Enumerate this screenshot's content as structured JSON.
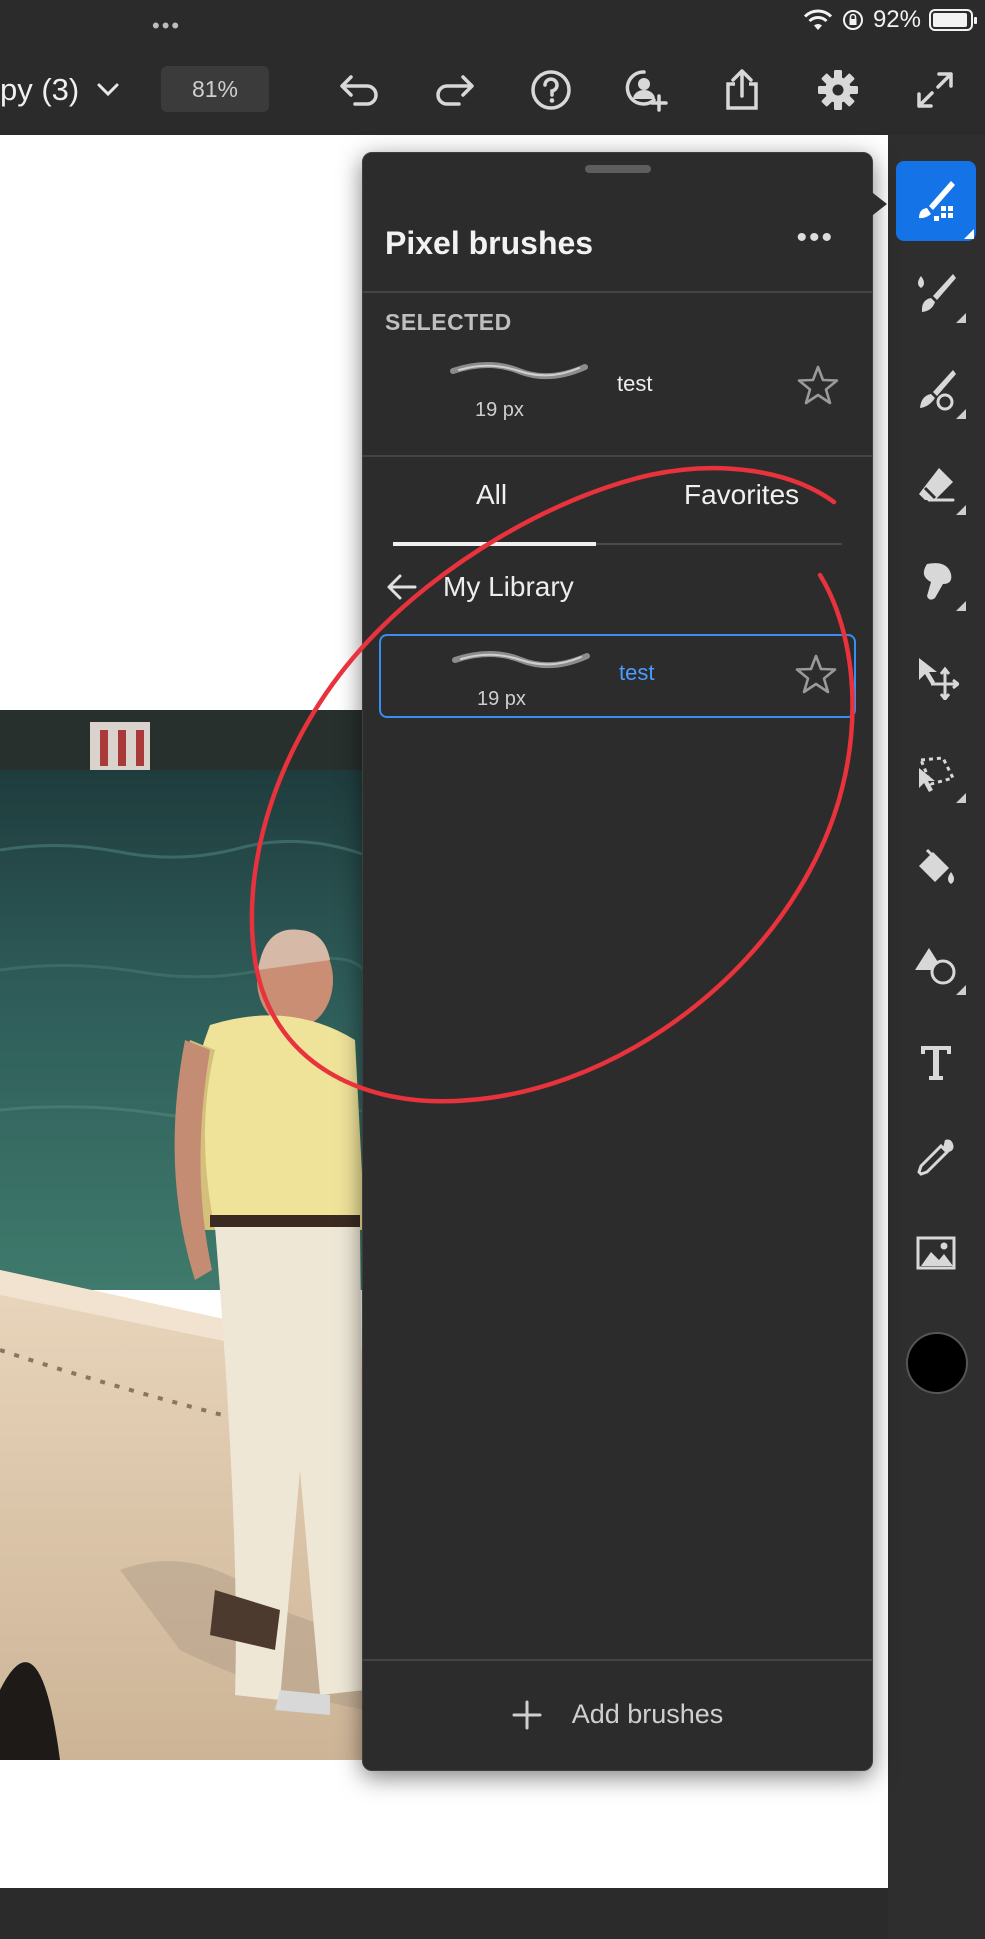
{
  "status_bar": {
    "more_dots": "•••",
    "battery_percent": "92%",
    "battery_level": 0.92
  },
  "toolbar": {
    "document_title": "py (3)",
    "zoom": "81%"
  },
  "panel": {
    "title": "Pixel brushes",
    "more": "•••",
    "selected_label": "SELECTED",
    "selected_brush": {
      "name": "test",
      "size": "19 px",
      "favorited": false
    },
    "tabs": [
      {
        "label": "All",
        "active": true
      },
      {
        "label": "Favorites",
        "active": false
      }
    ],
    "library_label": "My Library",
    "library_brushes": [
      {
        "name": "test",
        "size": "19 px",
        "selected": true,
        "favorited": false
      }
    ],
    "add_brushes_label": "Add brushes"
  },
  "colors": {
    "accent": "#1473e6",
    "selected_outline": "#378ef0",
    "annotation": "#e8323c",
    "current_color": "#000000"
  },
  "tools": [
    "pixel-brushes-icon",
    "paint-brush-icon",
    "healing-brush-icon",
    "eraser-icon",
    "smudge-icon",
    "move-icon",
    "lasso-select-icon",
    "paint-bucket-icon",
    "shapes-icon",
    "text-icon",
    "eyedropper-icon",
    "place-image-icon"
  ]
}
